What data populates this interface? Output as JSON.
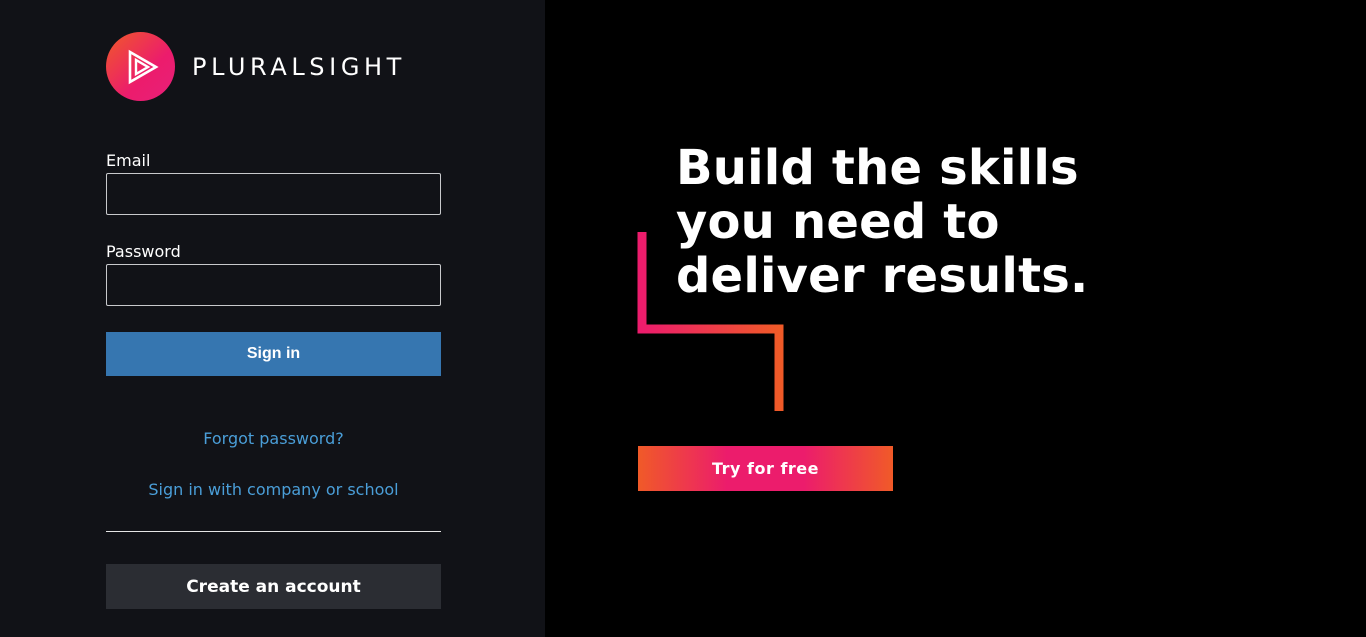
{
  "brand": {
    "name": "PLURALSIGHT"
  },
  "signin_form": {
    "email_label": "Email",
    "email_value": "",
    "password_label": "Password",
    "password_value": "",
    "signin_label": "Sign in",
    "forgot_password_label": "Forgot password?",
    "company_signin_label": "Sign in with company or school",
    "create_account_label": "Create an account"
  },
  "hero": {
    "headline_lines": [
      "Build the skills",
      "you need to",
      "deliver results."
    ],
    "cta_label": "Try for free"
  },
  "colors": {
    "left_panel_bg": "#111217",
    "right_panel_bg": "#000000",
    "signin_button": "#3676b0",
    "link": "#4a9ed8",
    "create_button": "#2b2d33",
    "brand_pink": "#ec1c6c",
    "brand_orange": "#f05a28"
  }
}
